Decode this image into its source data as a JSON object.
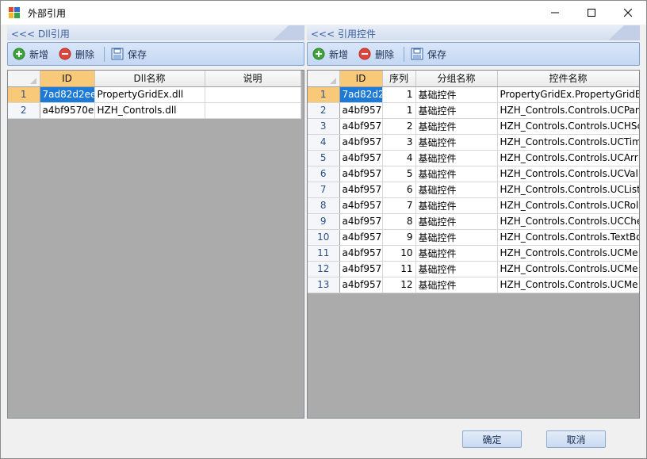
{
  "window": {
    "title": "外部引用"
  },
  "left_panel": {
    "title": "<<< Dll引用",
    "toolbar": {
      "add": "新增",
      "delete": "删除",
      "save": "保存"
    },
    "columns": [
      "ID",
      "Dll名称",
      "说明"
    ],
    "rows": [
      {
        "num": "1",
        "id": "7ad82d2ee",
        "name": "PropertyGridEx.dll",
        "desc": ""
      },
      {
        "num": "2",
        "id": "a4bf9570el",
        "name": "HZH_Controls.dll",
        "desc": ""
      }
    ]
  },
  "right_panel": {
    "title": "<<< 引用控件",
    "toolbar": {
      "add": "新增",
      "delete": "删除",
      "save": "保存"
    },
    "columns": [
      "ID",
      "序列",
      "分组名称",
      "控件名称"
    ],
    "rows": [
      {
        "num": "1",
        "id": "7ad82d2",
        "seq": "1",
        "group": "基础控件",
        "control": "PropertyGridEx.PropertyGridE"
      },
      {
        "num": "2",
        "id": "a4bf957",
        "seq": "1",
        "group": "基础控件",
        "control": "HZH_Controls.Controls.UCPan"
      },
      {
        "num": "3",
        "id": "a4bf957",
        "seq": "2",
        "group": "基础控件",
        "control": "HZH_Controls.Controls.UCHSc"
      },
      {
        "num": "4",
        "id": "a4bf957",
        "seq": "3",
        "group": "基础控件",
        "control": "HZH_Controls.Controls.UCTim"
      },
      {
        "num": "5",
        "id": "a4bf957",
        "seq": "4",
        "group": "基础控件",
        "control": "HZH_Controls.Controls.UCArr"
      },
      {
        "num": "6",
        "id": "a4bf957",
        "seq": "5",
        "group": "基础控件",
        "control": "HZH_Controls.Controls.UCVal"
      },
      {
        "num": "7",
        "id": "a4bf957",
        "seq": "6",
        "group": "基础控件",
        "control": "HZH_Controls.Controls.UCList"
      },
      {
        "num": "8",
        "id": "a4bf957",
        "seq": "7",
        "group": "基础控件",
        "control": "HZH_Controls.Controls.UCRol"
      },
      {
        "num": "9",
        "id": "a4bf957",
        "seq": "8",
        "group": "基础控件",
        "control": "HZH_Controls.Controls.UCChe"
      },
      {
        "num": "10",
        "id": "a4bf957",
        "seq": "9",
        "group": "基础控件",
        "control": "HZH_Controls.Controls.TextBo"
      },
      {
        "num": "11",
        "id": "a4bf957",
        "seq": "10",
        "group": "基础控件",
        "control": "HZH_Controls.Controls.UCMe"
      },
      {
        "num": "12",
        "id": "a4bf957",
        "seq": "11",
        "group": "基础控件",
        "control": "HZH_Controls.Controls.UCMe"
      },
      {
        "num": "13",
        "id": "a4bf957",
        "seq": "12",
        "group": "基础控件",
        "control": "HZH_Controls.Controls.UCMe"
      }
    ]
  },
  "footer": {
    "ok": "确定",
    "cancel": "取消"
  },
  "icons": {
    "app": "app-icon",
    "add": "plus-circle-icon",
    "delete": "minus-circle-icon",
    "save": "save-icon"
  },
  "colors": {
    "selection": "#1e7ad7",
    "selected_header": "#f7c978",
    "grid_background": "#ababab",
    "panel_title": "#3c5f9b"
  }
}
